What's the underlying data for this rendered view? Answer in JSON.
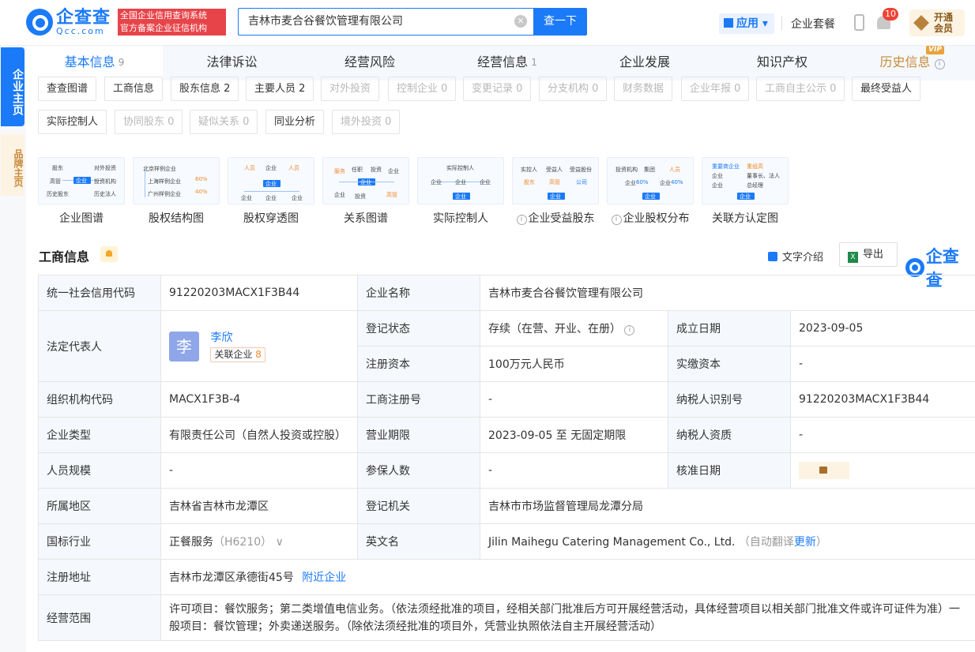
{
  "header": {
    "logo_main": "企查查",
    "logo_sub": "Qcc.com",
    "slogan_line1": "全国企业信用查询系统",
    "slogan_line2": "官方备案企业征信机构",
    "search_value": "吉林市麦合谷餐饮管理有限公司",
    "search_button": "查一下",
    "apps_label": "应用",
    "package_label": "企业套餐",
    "notif_count": "10",
    "vip_label": "开通会员"
  },
  "sidebar": {
    "item1": "企业主页",
    "item2": "品牌主页"
  },
  "tabs": [
    {
      "label": "基本信息",
      "count": "9"
    },
    {
      "label": "法律诉讼",
      "count": ""
    },
    {
      "label": "经营风险",
      "count": ""
    },
    {
      "label": "经营信息",
      "count": "1"
    },
    {
      "label": "企业发展",
      "count": ""
    },
    {
      "label": "知识产权",
      "count": ""
    },
    {
      "label": "历史信息",
      "count": ""
    }
  ],
  "vip_tag": "VIP",
  "chips": [
    {
      "label": "查查图谱"
    },
    {
      "label": "工商信息"
    },
    {
      "label": "股东信息 2"
    },
    {
      "label": "主要人员 2"
    },
    {
      "label": "对外投资"
    },
    {
      "label": "控制企业 0"
    },
    {
      "label": "变更记录 0"
    },
    {
      "label": "分支机构 0"
    },
    {
      "label": "财务数据"
    },
    {
      "label": "企业年报 0"
    },
    {
      "label": "工商自主公示 0"
    },
    {
      "label": "最终受益人"
    },
    {
      "label": "实际控制人"
    },
    {
      "label": "协同股东 0"
    },
    {
      "label": "疑似关系 0"
    },
    {
      "label": "同业分析"
    },
    {
      "label": "境外投资 0"
    }
  ],
  "cards": [
    {
      "label": "企业图谱"
    },
    {
      "label": "股权结构图"
    },
    {
      "label": "股权穿透图"
    },
    {
      "label": "关系图谱"
    },
    {
      "label": "实际控制人"
    },
    {
      "label": "企业受益股东"
    },
    {
      "label": "企业股权分布"
    },
    {
      "label": "关联方认定图"
    }
  ],
  "card_text": {
    "c1": [
      "股东",
      "对外投资",
      "高管",
      "企业",
      "投资机构",
      "历史股东",
      "历史法人"
    ],
    "c2": [
      "北京样例企业",
      "上海样例企业",
      "广州样例企业",
      "60%",
      "40%"
    ],
    "c3": [
      "人员",
      "企业",
      "人员",
      "企业",
      "企业",
      "企业",
      "企业"
    ],
    "c4": [
      "服务",
      "任职",
      "投资",
      "企业",
      "企业",
      "企业",
      "投资",
      "高管"
    ],
    "c5": [
      "实际控制人",
      "企业",
      "企业",
      "企业",
      "企业"
    ],
    "c6": [
      "实控人",
      "受益人",
      "受益股份",
      "股东",
      "高管",
      "公司",
      "企业"
    ],
    "c7": [
      "投资机构",
      "集团",
      "人员",
      "企业",
      "60%",
      "企业",
      "40%",
      "企业"
    ],
    "c8": [
      "重要商企业",
      "重组高",
      "企业",
      "董事长、法人",
      "企业",
      "总经理",
      "企业"
    ]
  },
  "section": {
    "title": "工商信息",
    "word_intro": "文字介绍",
    "export": "导出",
    "brand": "企查查"
  },
  "info": {
    "credit_code_k": "统一社会信用代码",
    "credit_code_v": "91220203MACX1F3B44",
    "name_k": "企业名称",
    "name_v": "吉林市麦合谷餐饮管理有限公司",
    "legal_k": "法定代表人",
    "legal_avatar": "李",
    "legal_name": "李欣",
    "legal_assoc": "关联企业",
    "legal_assoc_count": "8",
    "status_k": "登记状态",
    "status_v": "存续（在营、开业、在册）",
    "found_k": "成立日期",
    "found_v": "2023-09-05",
    "capital_k": "注册资本",
    "capital_v": "100万元人民币",
    "paid_k": "实缴资本",
    "paid_v": "-",
    "org_k": "组织机构代码",
    "org_v": "MACX1F3B-4",
    "reg_no_k": "工商注册号",
    "reg_no_v": "-",
    "tax_k": "纳税人识别号",
    "tax_v": "91220203MACX1F3B44",
    "type_k": "企业类型",
    "type_v": "有限责任公司（自然人投资或控股）",
    "term_k": "营业期限",
    "term_v": "2023-09-05 至 无固定期限",
    "taxq_k": "纳税人资质",
    "taxq_v": "-",
    "staff_k": "人员规模",
    "staff_v": "-",
    "insured_k": "参保人数",
    "insured_v": "-",
    "approve_k": "核准日期",
    "region_k": "所属地区",
    "region_v": "吉林省吉林市龙潭区",
    "authority_k": "登记机关",
    "authority_v": "吉林市市场监督管理局龙潭分局",
    "industry_k": "国标行业",
    "industry_v": "正餐服务",
    "industry_code": "（H6210）",
    "en_k": "英文名",
    "en_v": "Jilin Maihegu Catering Management Co., Ltd.",
    "en_auto": "（自动翻译",
    "en_update": "更新",
    "en_close": "）",
    "addr_k": "注册地址",
    "addr_v": "吉林市龙潭区承德街45号",
    "addr_link": "附近企业",
    "scope_k": "经营范围",
    "scope_v": "许可项目：餐饮服务；第二类增值电信业务。（依法须经批准的项目，经相关部门批准后方可开展经营活动，具体经营项目以相关部门批准文件或许可证件为准）一般项目：餐饮管理；外卖递送服务。（除依法须经批准的项目外，凭营业执照依法自主开展经营活动）"
  }
}
